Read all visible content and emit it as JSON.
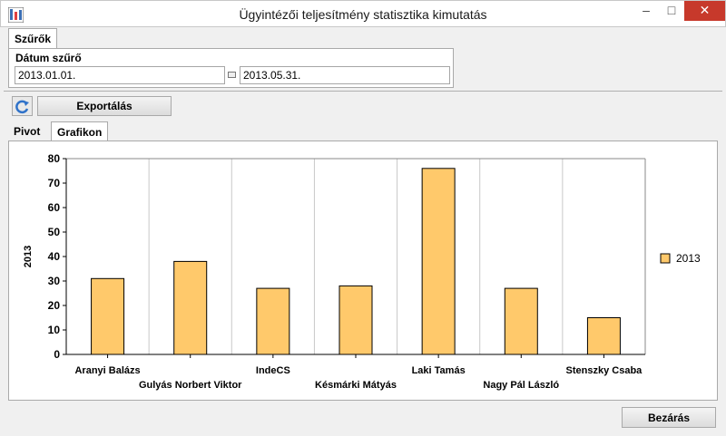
{
  "window": {
    "title": "Ügyintézői teljesítmény statisztika kimutatás",
    "min_glyph": "–",
    "max_glyph": "□",
    "close_glyph": "✕"
  },
  "filters_tab": {
    "label": "Szűrők"
  },
  "date_filter": {
    "title": "Dátum szűrő",
    "from_value": "2013.01.01.",
    "to_value": "2013.05.31."
  },
  "toolbar": {
    "export_label": "Exportálás",
    "refresh_icon": "refresh-icon"
  },
  "view_tabs": [
    {
      "label": "Pivot",
      "active": false
    },
    {
      "label": "Grafikon",
      "active": true
    }
  ],
  "chart_data": {
    "type": "bar",
    "categories": [
      "Aranyi Balázs",
      "Gulyás Norbert Viktor",
      "IndeCS",
      "Késmárki Mátyás",
      "Laki Tamás",
      "Nagy Pál László",
      "Stenszky Csaba"
    ],
    "series": [
      {
        "name": "2013",
        "values": [
          31,
          38,
          27,
          28,
          76,
          27,
          15
        ],
        "color": "#ffc96b"
      }
    ],
    "ylabel": "2013",
    "xlabel": "",
    "ylim": [
      0,
      80
    ],
    "yticks": [
      0,
      10,
      20,
      30,
      40,
      50,
      60,
      70,
      80
    ],
    "grid": "vertical",
    "legend": "right"
  },
  "footer": {
    "close_label": "Bezárás"
  }
}
